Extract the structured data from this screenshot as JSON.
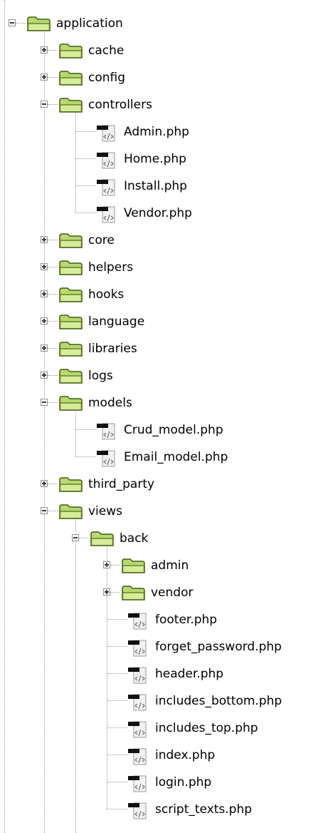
{
  "tree": {
    "items": [
      {
        "label": "application",
        "depth": 0,
        "type": "folder",
        "state": "expanded"
      },
      {
        "label": "cache",
        "depth": 1,
        "type": "folder",
        "state": "collapsed"
      },
      {
        "label": "config",
        "depth": 1,
        "type": "folder",
        "state": "collapsed"
      },
      {
        "label": "controllers",
        "depth": 1,
        "type": "folder",
        "state": "expanded"
      },
      {
        "label": "Admin.php",
        "depth": 2,
        "type": "file"
      },
      {
        "label": "Home.php",
        "depth": 2,
        "type": "file"
      },
      {
        "label": "Install.php",
        "depth": 2,
        "type": "file"
      },
      {
        "label": "Vendor.php",
        "depth": 2,
        "type": "file"
      },
      {
        "label": "core",
        "depth": 1,
        "type": "folder",
        "state": "collapsed"
      },
      {
        "label": "helpers",
        "depth": 1,
        "type": "folder",
        "state": "collapsed"
      },
      {
        "label": "hooks",
        "depth": 1,
        "type": "folder",
        "state": "collapsed"
      },
      {
        "label": "language",
        "depth": 1,
        "type": "folder",
        "state": "collapsed"
      },
      {
        "label": "libraries",
        "depth": 1,
        "type": "folder",
        "state": "collapsed"
      },
      {
        "label": "logs",
        "depth": 1,
        "type": "folder",
        "state": "collapsed"
      },
      {
        "label": "models",
        "depth": 1,
        "type": "folder",
        "state": "expanded"
      },
      {
        "label": "Crud_model.php",
        "depth": 2,
        "type": "file"
      },
      {
        "label": "Email_model.php",
        "depth": 2,
        "type": "file"
      },
      {
        "label": "third_party",
        "depth": 1,
        "type": "folder",
        "state": "collapsed"
      },
      {
        "label": "views",
        "depth": 1,
        "type": "folder",
        "state": "expanded"
      },
      {
        "label": "back",
        "depth": 2,
        "type": "folder",
        "state": "expanded"
      },
      {
        "label": "admin",
        "depth": 3,
        "type": "folder",
        "state": "collapsed"
      },
      {
        "label": "vendor",
        "depth": 3,
        "type": "folder",
        "state": "collapsed"
      },
      {
        "label": "footer.php",
        "depth": 3,
        "type": "file"
      },
      {
        "label": "forget_password.php",
        "depth": 3,
        "type": "file"
      },
      {
        "label": "header.php",
        "depth": 3,
        "type": "file"
      },
      {
        "label": "includes_bottom.php",
        "depth": 3,
        "type": "file"
      },
      {
        "label": "includes_top.php",
        "depth": 3,
        "type": "file"
      },
      {
        "label": "index.php",
        "depth": 3,
        "type": "file"
      },
      {
        "label": "login.php",
        "depth": 3,
        "type": "file"
      },
      {
        "label": "script_texts.php",
        "depth": 3,
        "type": "file"
      }
    ]
  },
  "colors": {
    "folder_green": "#b8d870",
    "folder_outline": "#3f5f10",
    "file_grey": "#9a9a9a",
    "guide_line": "#9a9a9a"
  },
  "icons": {
    "folder": "folder-icon",
    "file": "php-file-icon",
    "expanded": "expand-minus-icon",
    "collapsed": "expand-plus-icon"
  }
}
